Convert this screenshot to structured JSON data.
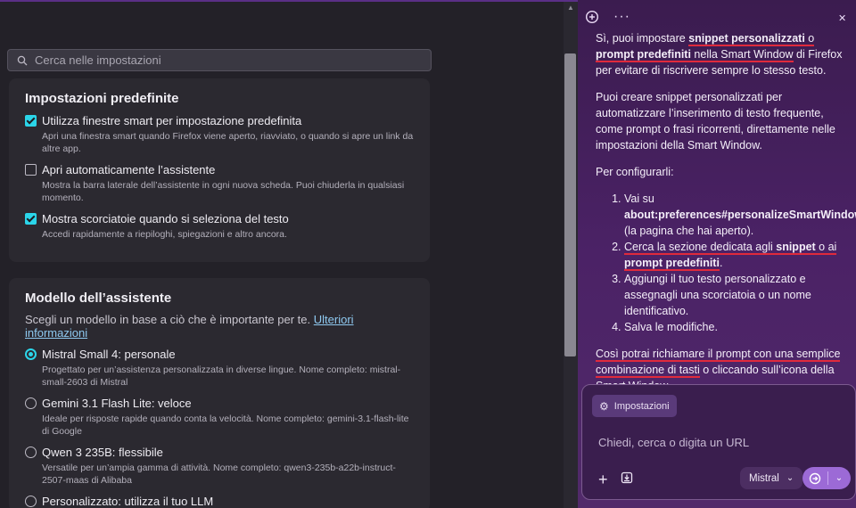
{
  "settings": {
    "search_placeholder": "Cerca nelle impostazioni",
    "defaults_section": {
      "title": "Impostazioni predefinite",
      "options": [
        {
          "label": "Utilizza finestre smart per impostazione predefinita",
          "desc": "Apri una finestra smart quando Firefox viene aperto, riavviato, o quando si apre un link da altre app.",
          "checked": true
        },
        {
          "label": "Apri automaticamente l’assistente",
          "desc": "Mostra la barra laterale dell’assistente in ogni nuova scheda. Puoi chiuderla in qualsiasi momento.",
          "checked": false
        },
        {
          "label": "Mostra scorciatoie quando si seleziona del testo",
          "desc": "Accedi rapidamente a riepiloghi, spiegazioni e altro ancora.",
          "checked": true
        }
      ]
    },
    "model_section": {
      "title": "Modello dell’assistente",
      "subtitle": "Scegli un modello in base a ciò che è importante per te.",
      "link": "Ulteriori informazioni",
      "models": [
        {
          "label": "Mistral Small 4: personale",
          "desc": "Progettato per un’assistenza personalizzata in diverse lingue. Nome completo: mistral-small-2603 di Mistral",
          "selected": true
        },
        {
          "label": "Gemini 3.1 Flash Lite: veloce",
          "desc": "Ideale per risposte rapide quando conta la velocità. Nome completo: gemini-3.1-flash-lite di Google",
          "selected": false
        },
        {
          "label": "Qwen 3 235B: flessibile",
          "desc": "Versatile per un’ampia gamma di attività. Nome completo: qwen3-235b-a22b-instruct-2507-maas di Alibaba",
          "selected": false
        },
        {
          "label": "Personalizzato: utilizza il tuo LLM",
          "desc": "",
          "selected": false
        }
      ]
    }
  },
  "assistant": {
    "p1": {
      "a": "Sì, puoi impostare ",
      "b": "snippet personalizzati",
      "c": " o ",
      "d": "prompt predefiniti",
      "e": " nella Smart Window",
      "f": " di Firefox per evitare di riscrivere sempre lo stesso testo."
    },
    "p2": "Puoi creare snippet personalizzati per automatizzare l’inserimento di testo frequente, come prompt o frasi ricorrenti, direttamente nelle impostazioni della Smart Window.",
    "p3": "Per configurarli:",
    "steps": {
      "s1a": "Vai su ",
      "s1b": "about:preferences#personalizeSmartWindow",
      "s1c": " (la pagina che hai aperto).",
      "s2a": "Cerca la sezione dedicata agli ",
      "s2b": "snippet",
      "s2c": " o ai ",
      "s2d": "prompt predefiniti",
      "s2e": ".",
      "s3": "Aggiungi il tuo testo personalizzato e assegnagli una scorciatoia o un nome identificativo.",
      "s4": "Salva le modifiche."
    },
    "p4": {
      "a": "Così potrai richiamare il prompt con una semplice combinazione di tasti",
      "b": " o cliccando sull’icona della Smart Window."
    }
  },
  "composer": {
    "chip_label": "Impostazioni",
    "input_placeholder": "Chiedi, cerca o digita un URL",
    "model": "Mistral"
  },
  "colors": {
    "accent": "#2bd5e9",
    "link": "#8ec9f0",
    "panel_bg": "#4b2266",
    "annotation_underline": "#e02a3c",
    "send_button": "#9c6ad6"
  },
  "icons": [
    "search-icon",
    "new-chat-icon",
    "more-icon",
    "close-icon",
    "gear-icon",
    "plus-icon",
    "save-icon",
    "chevron-down-icon",
    "send-icon"
  ]
}
